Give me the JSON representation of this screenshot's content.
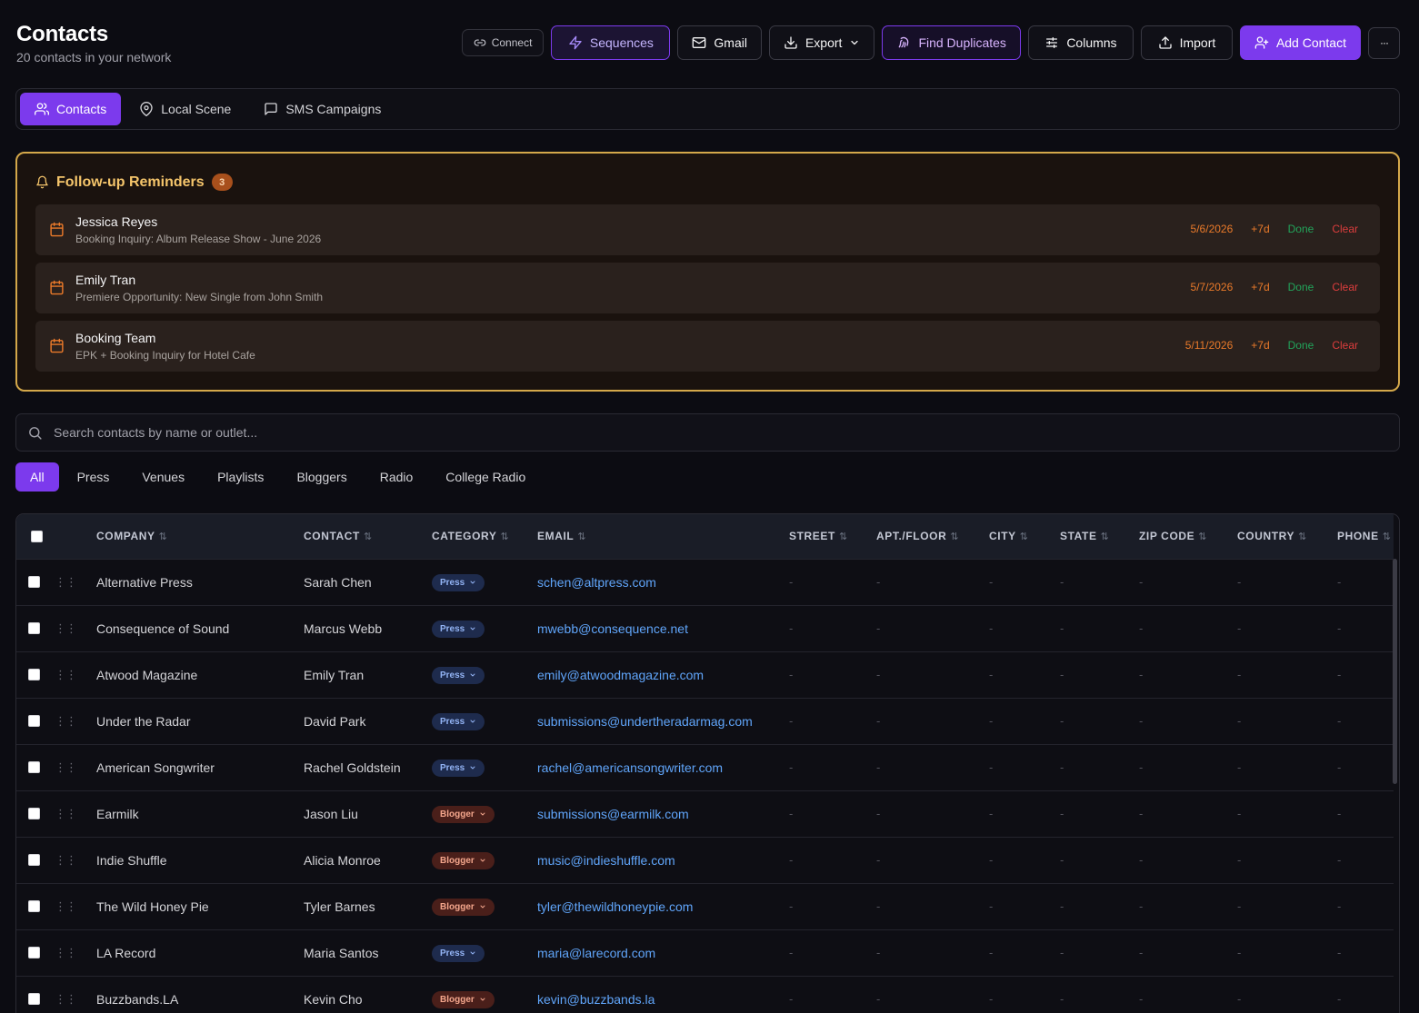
{
  "header": {
    "title": "Contacts",
    "subtitle": "20 contacts in your network",
    "buttons": {
      "connect": "Connect",
      "sequences": "Sequences",
      "gmail": "Gmail",
      "export": "Export",
      "find_duplicates": "Find Duplicates",
      "columns": "Columns",
      "import": "Import",
      "add_contact": "Add Contact",
      "more": "···"
    }
  },
  "tabs": [
    {
      "label": "Contacts",
      "icon": "users-icon",
      "active": true
    },
    {
      "label": "Local Scene",
      "icon": "map-pin-icon",
      "active": false
    },
    {
      "label": "SMS Campaigns",
      "icon": "message-square-icon",
      "active": false
    }
  ],
  "reminders": {
    "title": "Follow-up Reminders",
    "count": "3",
    "items": [
      {
        "name": "Jessica Reyes",
        "subject": "Booking Inquiry: Album Release Show - June 2026",
        "date": "5/6/2026",
        "snooze": "+7d",
        "done": "Done",
        "clear": "Clear"
      },
      {
        "name": "Emily Tran",
        "subject": "Premiere Opportunity: New Single from John Smith",
        "date": "5/7/2026",
        "snooze": "+7d",
        "done": "Done",
        "clear": "Clear"
      },
      {
        "name": "Booking Team",
        "subject": "EPK + Booking Inquiry for Hotel Cafe",
        "date": "5/11/2026",
        "snooze": "+7d",
        "done": "Done",
        "clear": "Clear"
      }
    ]
  },
  "search": {
    "placeholder": "Search contacts by name or outlet..."
  },
  "filters": [
    "All",
    "Press",
    "Venues",
    "Playlists",
    "Bloggers",
    "Radio",
    "College Radio"
  ],
  "table": {
    "columns": [
      "COMPANY",
      "CONTACT",
      "CATEGORY",
      "EMAIL",
      "STREET",
      "APT./FLOOR",
      "CITY",
      "STATE",
      "ZIP CODE",
      "COUNTRY",
      "PHONE"
    ],
    "empty": "-",
    "rows": [
      {
        "company": "Alternative Press",
        "contact": "Sarah Chen",
        "category": "Press",
        "email": "schen@altpress.com"
      },
      {
        "company": "Consequence of Sound",
        "contact": "Marcus Webb",
        "category": "Press",
        "email": "mwebb@consequence.net"
      },
      {
        "company": "Atwood Magazine",
        "contact": "Emily Tran",
        "category": "Press",
        "email": "emily@atwoodmagazine.com"
      },
      {
        "company": "Under the Radar",
        "contact": "David Park",
        "category": "Press",
        "email": "submissions@undertheradarmag.com"
      },
      {
        "company": "American Songwriter",
        "contact": "Rachel Goldstein",
        "category": "Press",
        "email": "rachel@americansongwriter.com"
      },
      {
        "company": "Earmilk",
        "contact": "Jason Liu",
        "category": "Blogger",
        "email": "submissions@earmilk.com"
      },
      {
        "company": "Indie Shuffle",
        "contact": "Alicia Monroe",
        "category": "Blogger",
        "email": "music@indieshuffle.com"
      },
      {
        "company": "The Wild Honey Pie",
        "contact": "Tyler Barnes",
        "category": "Blogger",
        "email": "tyler@thewildhoneypie.com"
      },
      {
        "company": "LA Record",
        "contact": "Maria Santos",
        "category": "Press",
        "email": "maria@larecord.com"
      },
      {
        "company": "Buzzbands.LA",
        "contact": "Kevin Cho",
        "category": "Blogger",
        "email": "kevin@buzzbands.la"
      }
    ]
  },
  "colors": {
    "accent": "#7c3aed",
    "reminder_border": "#d4a84a",
    "link": "#60a5fa",
    "done": "#22a35a",
    "clear": "#dc3d3d",
    "date": "#ea7a2a"
  }
}
